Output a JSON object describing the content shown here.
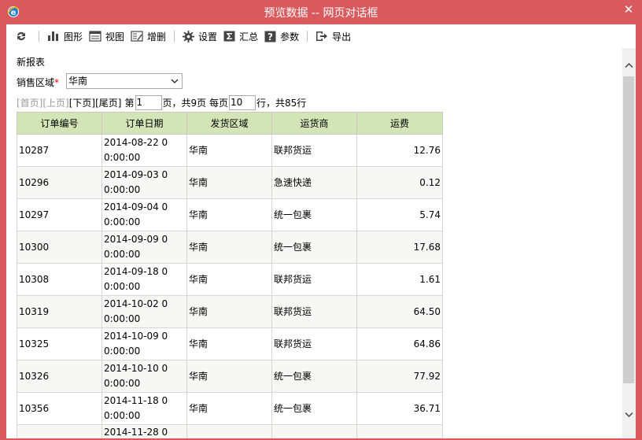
{
  "window": {
    "title": "预览数据 -- 网页对话框"
  },
  "toolbar": {
    "items": [
      {
        "icon": "refresh-icon"
      },
      {
        "label": "图形",
        "icon": "bar-chart-icon"
      },
      {
        "label": "视图",
        "icon": "view-icon"
      },
      {
        "label": "增删",
        "icon": "edit-icon"
      },
      {
        "label": "设置",
        "icon": "gear-icon"
      },
      {
        "label": "汇总",
        "icon": "sigma-icon"
      },
      {
        "label": "参数",
        "icon": "question-icon"
      },
      {
        "label": "导出",
        "icon": "export-icon"
      }
    ]
  },
  "report": {
    "name": "新报表"
  },
  "filter": {
    "label": "销售区域",
    "required_mark": "*",
    "value": "华南"
  },
  "pager": {
    "first": "[首页]",
    "prev": "[上页]",
    "next": "[下页]",
    "last": "[尾页]",
    "page_prefix": "第",
    "page_value": "1",
    "page_suffix": "页，共9页 每页",
    "size_value": "10",
    "size_suffix": "行，共85行"
  },
  "table": {
    "headers": [
      "订单编号",
      "订单日期",
      "发货区域",
      "运货商",
      "运费"
    ],
    "rows": [
      {
        "id": "10287",
        "date": "2014-08-22 0",
        "time": "0:00:00",
        "region": "华南",
        "shipper": "联邦货运",
        "freight": "12.76"
      },
      {
        "id": "10296",
        "date": "2014-09-03 0",
        "time": "0:00:00",
        "region": "华南",
        "shipper": "急速快递",
        "freight": "0.12"
      },
      {
        "id": "10297",
        "date": "2014-09-04 0",
        "time": "0:00:00",
        "region": "华南",
        "shipper": "统一包裹",
        "freight": "5.74"
      },
      {
        "id": "10300",
        "date": "2014-09-09 0",
        "time": "0:00:00",
        "region": "华南",
        "shipper": "统一包裹",
        "freight": "17.68"
      },
      {
        "id": "10308",
        "date": "2014-09-18 0",
        "time": "0:00:00",
        "region": "华南",
        "shipper": "联邦货运",
        "freight": "1.61"
      },
      {
        "id": "10319",
        "date": "2014-10-02 0",
        "time": "0:00:00",
        "region": "华南",
        "shipper": "联邦货运",
        "freight": "64.50"
      },
      {
        "id": "10325",
        "date": "2014-10-09 0",
        "time": "0:00:00",
        "region": "华南",
        "shipper": "联邦货运",
        "freight": "64.86"
      },
      {
        "id": "10326",
        "date": "2014-10-10 0",
        "time": "0:00:00",
        "region": "华南",
        "shipper": "统一包裹",
        "freight": "77.92"
      },
      {
        "id": "10356",
        "date": "2014-11-18 0",
        "time": "0:00:00",
        "region": "华南",
        "shipper": "统一包裹",
        "freight": "36.71"
      },
      {
        "id": "",
        "date": "2014-11-28 0",
        "time": "",
        "region": "",
        "shipper": "",
        "freight": ""
      }
    ]
  },
  "colors": {
    "title_bar": "#d9595d",
    "header_bg": "#d3e5b7"
  }
}
